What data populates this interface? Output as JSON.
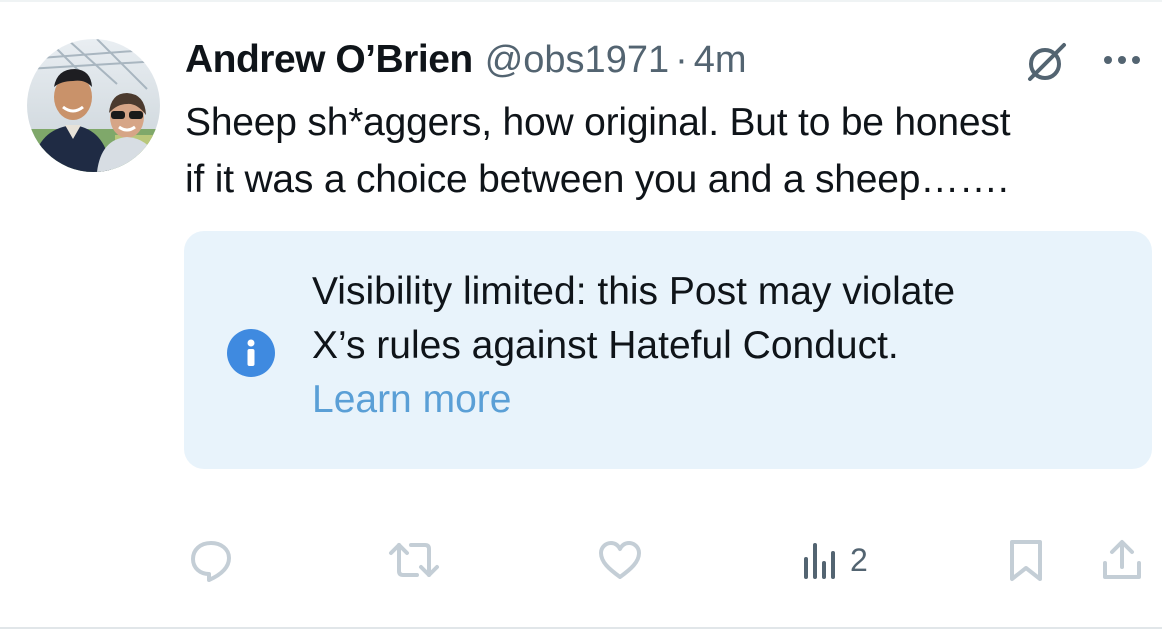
{
  "post": {
    "author_name": "Andrew O’Brien",
    "handle": "@obs1971",
    "separator": "·",
    "time": "4m",
    "text_line1": "Sheep sh*aggers, how original. But to be honest",
    "text_line2": "if it was a choice between you and a sheep…….",
    "avatar_icon": "avatar-photo",
    "grok_icon": "grok-icon",
    "more_icon": "more-options-icon"
  },
  "notice": {
    "line1": "Visibility limited: this Post may violate",
    "line2": "X’s rules against Hateful Conduct.",
    "link": "Learn more",
    "icon": "info-icon",
    "background": "#e8f3fb",
    "link_color": "#5a9fd6",
    "icon_color": "#3f8ae0"
  },
  "actions": {
    "reply_icon": "reply-icon",
    "repost_icon": "repost-icon",
    "like_icon": "like-icon",
    "views_icon": "views-icon",
    "views_count": "2",
    "bookmark_icon": "bookmark-icon",
    "share_icon": "share-icon",
    "disabled_color": "#c4ced6",
    "active_color": "#536471"
  }
}
